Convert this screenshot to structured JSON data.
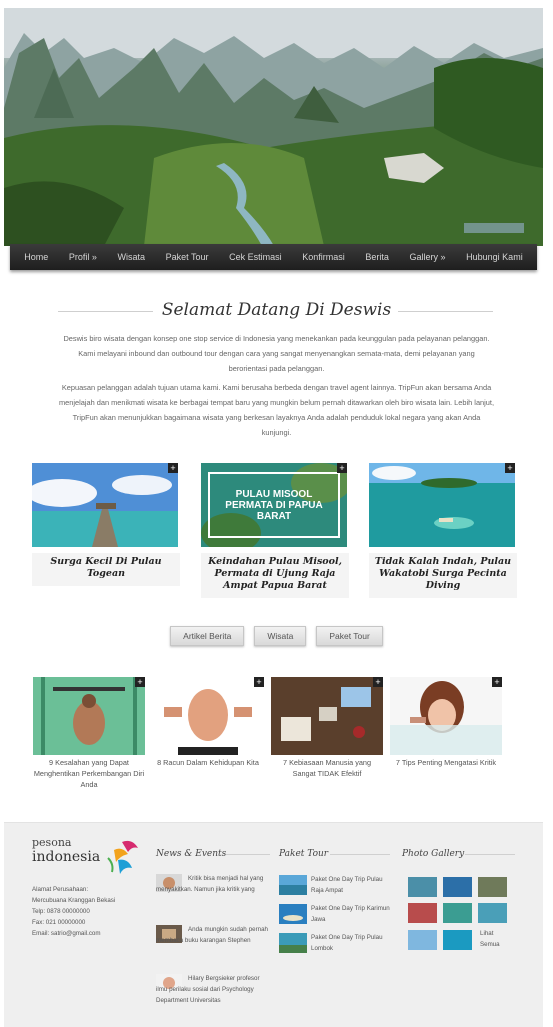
{
  "nav": {
    "items": [
      "Home",
      "Profil »",
      "Wisata",
      "Paket Tour",
      "Cek Estimasi",
      "Konfirmasi",
      "Berita",
      "Gallery »",
      "Hubungi Kami"
    ]
  },
  "welcome": {
    "title": "Selamat Datang Di Deswis",
    "p1": "Deswis biro wisata dengan konsep one stop service di Indonesia yang menekankan pada keunggulan pada pelayanan pelanggan. Kami melayani inbound dan outbound tour dengan cara yang sangat menyenangkan semata-mata, demi pelayanan yang berorientasi pada pelanggan.",
    "p2": "Kepuasan pelanggan adalah tujuan utama kami. Kami berusaha berbeda dengan travel agent lainnya. TripFun akan bersama Anda menjelajah dan menikmati wisata ke berbagai tempat baru yang mungkin belum pernah ditawarkan oleh biro wisata lain. Lebih lanjut, TripFun akan menunjukkan bagaimana wisata yang berkesan layaknya Anda adalah penduduk lokal negara yang akan Anda kunjungi."
  },
  "featured": [
    {
      "caption": "Surga Kecil Di Pulau Togean"
    },
    {
      "caption": "Keindahan Pulau Misool, Permata di Ujung Raja Ampat Papua Barat",
      "overlay": "PULAU MISOOL PERMATA DI PAPUA BARAT"
    },
    {
      "caption": "Tidak Kalah Indah, Pulau Wakatobi Surga Pecinta Diving"
    }
  ],
  "plus_glyph": "+",
  "buttons": [
    "Artikel Berita",
    "Wisata",
    "Paket Tour"
  ],
  "articles": [
    {
      "title": "9 Kesalahan yang Dapat Menghentikan Perkembangan Diri Anda"
    },
    {
      "title": "8 Racun Dalam Kehidupan Kita"
    },
    {
      "title": "7 Kebiasaan Manusia yang Sangat TIDAK Efektif"
    },
    {
      "title": "7 Tips Penting Mengatasi Kritik"
    }
  ],
  "footer": {
    "logo_top": "pesona",
    "logo_bottom": "indonesia",
    "address": [
      "Alamat Perusahaan:",
      "Mercubuana Kranggan Bekasi",
      "Telp: 0878 00000000",
      "Fax: 021 00000000",
      "Email: satrio@gmail.com"
    ],
    "news_heading": "News & Events",
    "news": [
      "Kritik bisa menjadi hal yang menyakitkan. Namun jika kritik yang",
      "Anda mungkin sudah pernah membaca buku karangan Stephen",
      "Hilary Bergsieker profesor ilmu perilaku sosial dari Psychology Department Universitas"
    ],
    "tour_heading": "Paket Tour",
    "tours": [
      "Paket One Day Trip Pulau Raja Ampat",
      "Paket One Day Trip Karimun Jawa",
      "Paket One Day Trip Pulau Lombok"
    ],
    "gallery_heading": "Photo Gallery",
    "gallery_more": "Lihat Semua"
  },
  "colors": {
    "nav_bg": "#2a2a2a",
    "footer_bg": "#efefef",
    "plus_bg": "#222222"
  }
}
